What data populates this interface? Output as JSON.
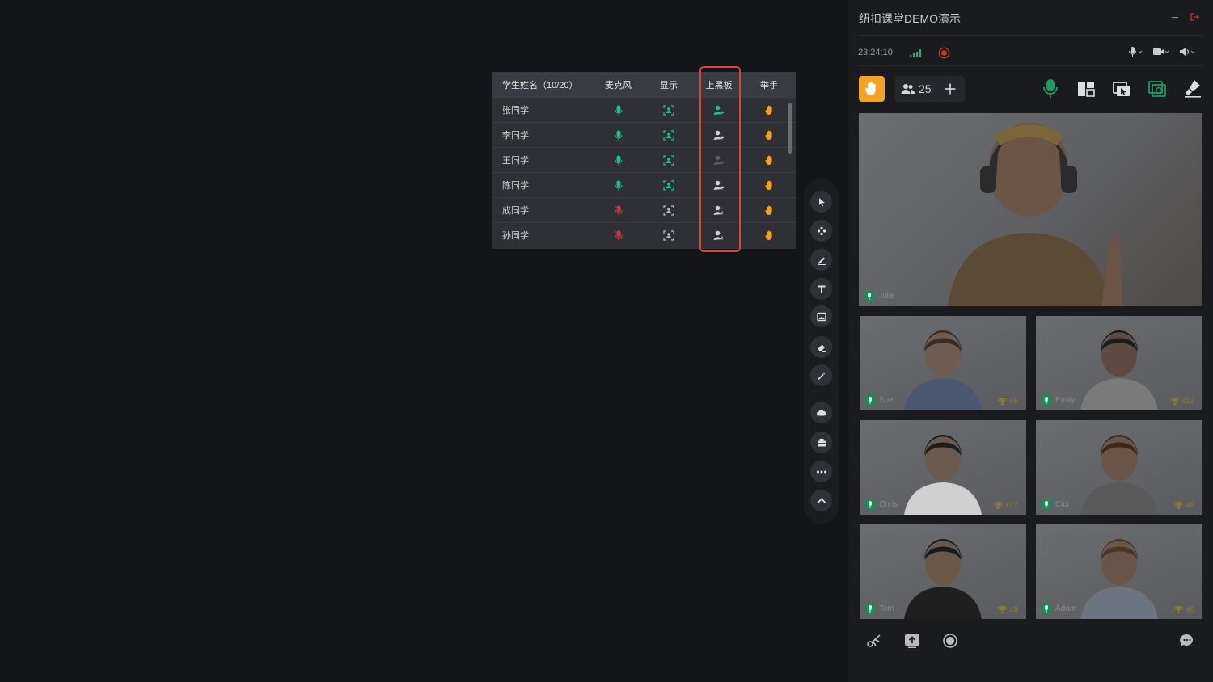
{
  "student_table": {
    "headers": {
      "name": "学生姓名（10/20）",
      "mic": "麦克风",
      "show": "显示",
      "board": "上黑板",
      "hand": "举手"
    },
    "rows": [
      {
        "name": "张同学",
        "mic": "on",
        "show": "on",
        "board": "active",
        "hand": "raised"
      },
      {
        "name": "李同学",
        "mic": "on",
        "show": "on",
        "board": "available",
        "hand": "raised"
      },
      {
        "name": "王同学",
        "mic": "on",
        "show": "on",
        "board": "disabled",
        "hand": "raised"
      },
      {
        "name": "陈同学",
        "mic": "on",
        "show": "on",
        "board": "available",
        "hand": "raised"
      },
      {
        "name": "成同学",
        "mic": "off",
        "show": "off",
        "board": "available",
        "hand": "raised"
      },
      {
        "name": "孙同学",
        "mic": "off",
        "show": "off",
        "board": "available",
        "hand": "raised"
      }
    ]
  },
  "toolbar": {
    "tools": [
      "cursor-icon",
      "move-icon",
      "pen-icon",
      "text-icon",
      "image-icon",
      "eraser-icon",
      "magic-wand-icon",
      "cloud-icon",
      "toolbox-icon",
      "more-icon",
      "collapse-icon"
    ]
  },
  "classroom": {
    "title": "纽扣课堂DEMO演示",
    "time": "23:24:10",
    "participant_count": "25"
  },
  "teacher": {
    "name": "Julie"
  },
  "students": [
    {
      "name": "Sue",
      "trophies": "x6"
    },
    {
      "name": "Emily",
      "trophies": "x12"
    },
    {
      "name": "Chris",
      "trophies": "x12"
    },
    {
      "name": "Cici",
      "trophies": "x8"
    },
    {
      "name": "Tom",
      "trophies": "x8"
    },
    {
      "name": "Adam",
      "trophies": "x6"
    }
  ],
  "colors": {
    "accent_green": "#22c38a",
    "mic_off_red": "#e23b3b",
    "hand_orange": "#f59e1f",
    "highlight_red": "#e0413c"
  }
}
